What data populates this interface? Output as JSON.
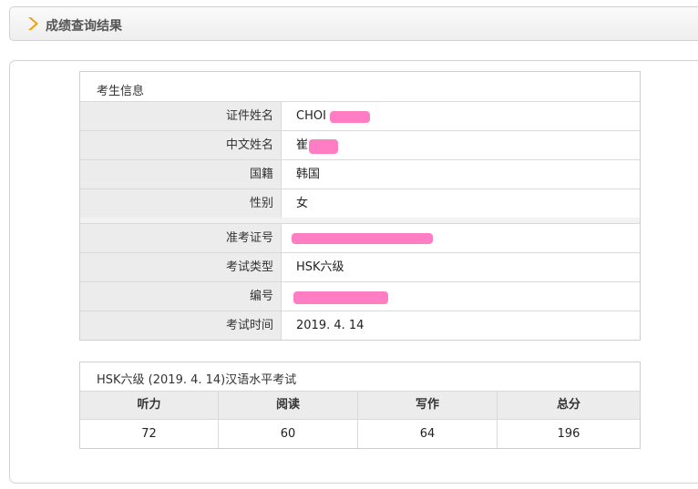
{
  "header": {
    "title": "成绩查询结果",
    "icon": "chevron-right-icon",
    "accent": "#f0a000"
  },
  "candidate": {
    "section_title": "考生信息",
    "fields": [
      {
        "label": "证件姓名",
        "value": "CHOI"
      },
      {
        "label": "中文姓名",
        "value": "崔"
      },
      {
        "label": "国籍",
        "value": "韩国"
      },
      {
        "label": "性别",
        "value": "女"
      },
      {
        "label": "准考证号",
        "value": ""
      },
      {
        "label": "考试类型",
        "value": "HSK六级"
      },
      {
        "label": "编号",
        "value": ""
      },
      {
        "label": "考试时间",
        "value": "2019. 4. 14"
      }
    ],
    "redaction_color": "#ff7dc3"
  },
  "scores": {
    "title": "HSK六级 (2019. 4. 14)汉语水平考试",
    "headers": [
      "听力",
      "阅读",
      "写作",
      "总分"
    ],
    "values": [
      "72",
      "60",
      "64",
      "196"
    ]
  }
}
